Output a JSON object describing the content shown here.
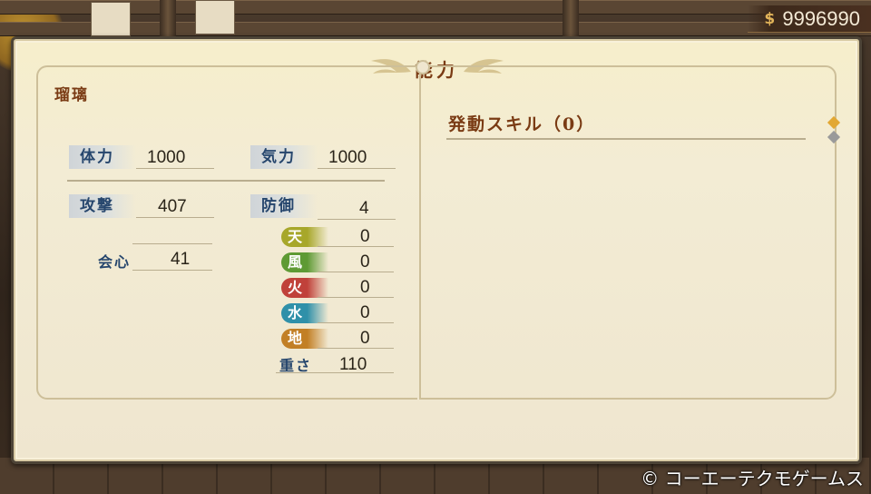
{
  "currency": {
    "icon": "coin-icon",
    "amount": "9996990"
  },
  "panel": {
    "title": "能力"
  },
  "character": {
    "name": "瑠璃"
  },
  "stats": {
    "stamina": {
      "label": "体力",
      "value": "1000"
    },
    "spirit": {
      "label": "気力",
      "value": "1000"
    },
    "attack": {
      "label": "攻撃",
      "value": "407"
    },
    "defense": {
      "label": "防御",
      "value": "4"
    },
    "critical": {
      "label": "会心",
      "value": "41"
    },
    "weight": {
      "label": "重さ",
      "value": "110"
    }
  },
  "elements": [
    {
      "label": "天",
      "value": "0",
      "color": "#a7a72a"
    },
    {
      "label": "風",
      "value": "0",
      "color": "#5e9a34"
    },
    {
      "label": "火",
      "value": "0",
      "color": "#c0413a"
    },
    {
      "label": "水",
      "value": "0",
      "color": "#2f90a9"
    },
    {
      "label": "地",
      "value": "0",
      "color": "#c27f25"
    }
  ],
  "skills": {
    "title": "発動スキル（0）"
  },
  "scroll_indicator_colors": {
    "active": "#e2a834",
    "inactive": "#9a9a9a"
  },
  "copyright": "© コーエーテクモゲームス"
}
